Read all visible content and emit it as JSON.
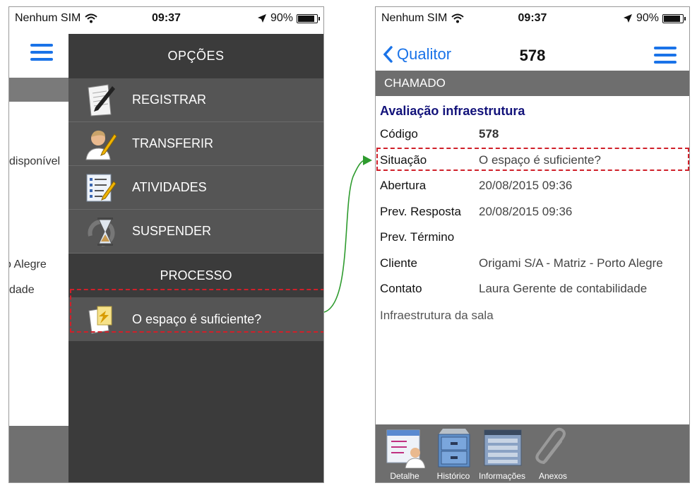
{
  "status": {
    "carrier": "Nenhum SIM",
    "time": "09:37",
    "battery": "90%",
    "battery_level": 0.9
  },
  "left_phone": {
    "background_texts": [
      "disponível",
      "o Alegre",
      "dade"
    ],
    "drawer": {
      "header": "OPÇÕES",
      "items": [
        {
          "label": "REGISTRAR",
          "icon": "pen-paper-icon"
        },
        {
          "label": "TRANSFERIR",
          "icon": "user-pen-icon"
        },
        {
          "label": "ATIVIDADES",
          "icon": "checklist-icon"
        },
        {
          "label": "SUSPENDER",
          "icon": "hourglass-icon"
        }
      ],
      "process_section": "PROCESSO",
      "process_item": {
        "label": "O espaço é suficiente?",
        "icon": "document-arrow-icon"
      }
    }
  },
  "right_phone": {
    "nav": {
      "back_label": "Qualitor",
      "title": "578"
    },
    "section": "CHAMADO",
    "card_title": "Avaliação infraestrutura",
    "fields": [
      {
        "label": "Código",
        "value": "578"
      },
      {
        "label": "Situação",
        "value": "O espaço é suficiente?"
      },
      {
        "label": "Abertura",
        "value": "20/08/2015 09:36"
      },
      {
        "label": "Prev. Resposta",
        "value": "20/08/2015 09:36"
      },
      {
        "label": "Prev. Término",
        "value": ""
      },
      {
        "label": "Cliente",
        "value": "Origami S/A - Matriz - Porto Alegre"
      },
      {
        "label": "Contato",
        "value": "Laura Gerente de contabilidade"
      }
    ],
    "description": "Infraestrutura da sala",
    "tabs": [
      {
        "label": "Detalhe",
        "icon": "detail-card-icon"
      },
      {
        "label": "Histórico",
        "icon": "file-cabinet-icon"
      },
      {
        "label": "Informações",
        "icon": "info-window-icon"
      },
      {
        "label": "Anexos",
        "icon": "paperclip-icon"
      }
    ]
  },
  "colors": {
    "accent": "#1a73e8",
    "highlight": "#d0202a",
    "connector": "#2e9b2e",
    "drawer_bg": "#3b3b3b",
    "band": "#6e6e6e"
  }
}
